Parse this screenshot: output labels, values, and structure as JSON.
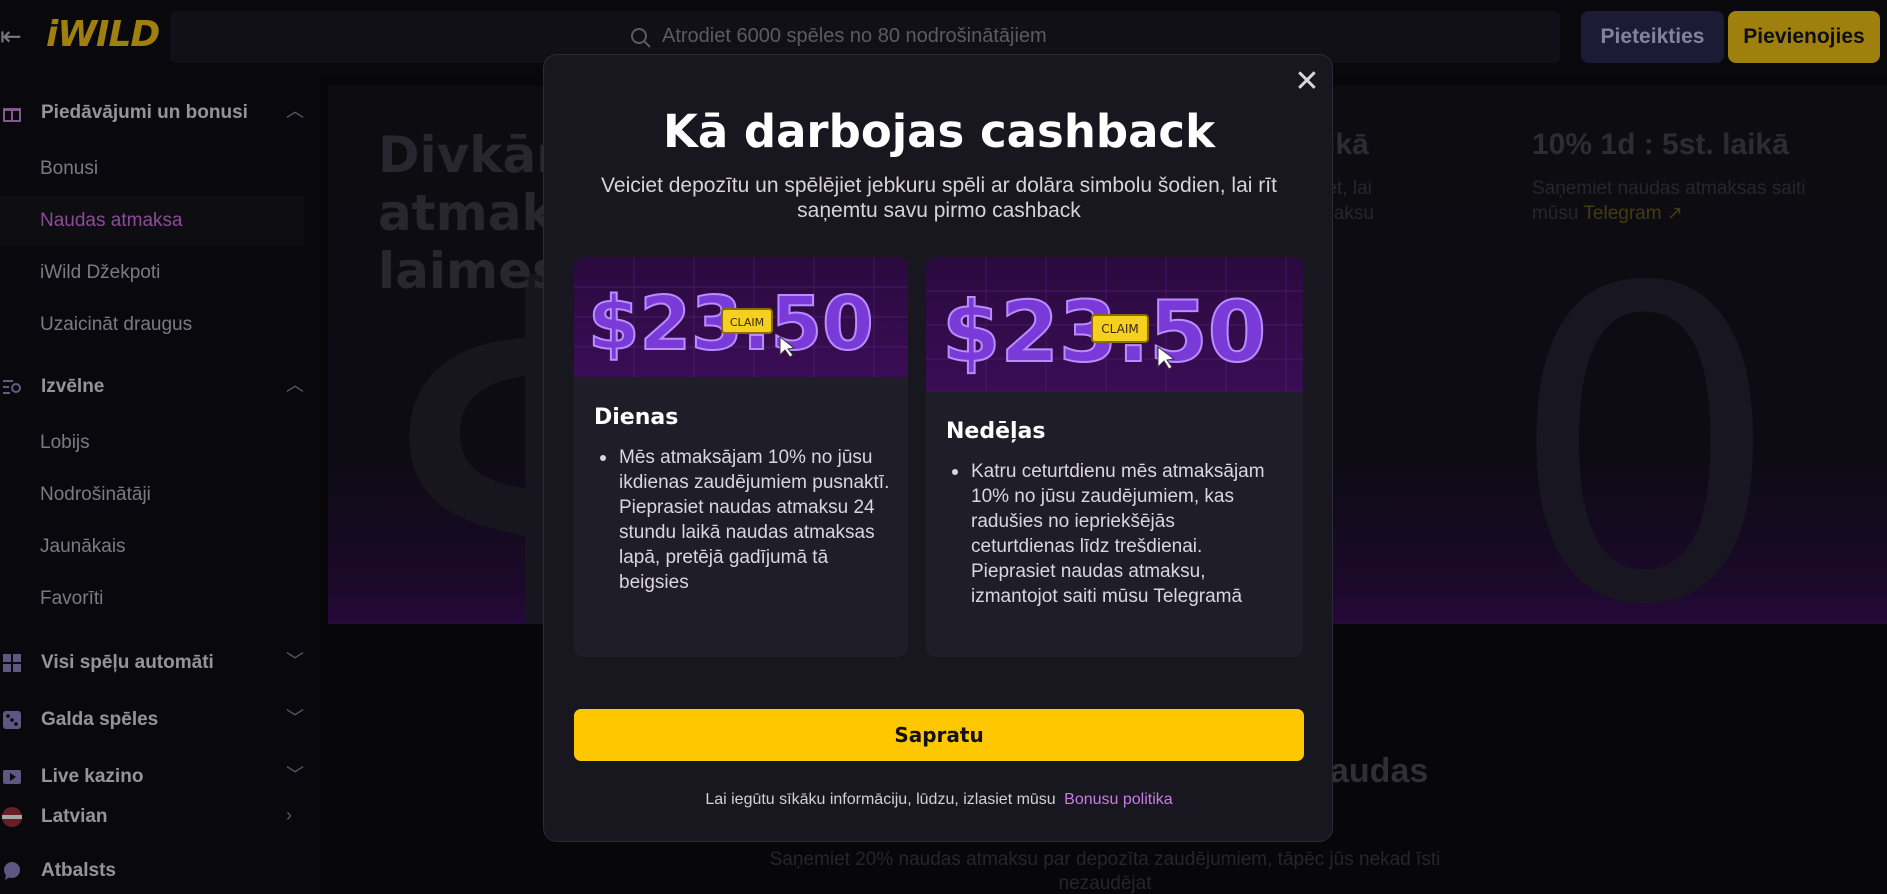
{
  "topbar": {
    "logo": "iWILD",
    "search_placeholder": "Atrodiet 6000 spēles no 80 nodrošinātājiem",
    "login_label": "Pieteikties",
    "join_label": "Pievienojies"
  },
  "sidebar": {
    "bonuses_section": "Piedāvājumi un bonusi",
    "bonus_items": [
      "Bonusi",
      "Naudas atmaksa",
      "iWild Džekpoti",
      "Uzaicināt draugus"
    ],
    "menu_section": "Izvēlne",
    "menu_items": [
      "Lobijs",
      "Nodrošinātāji",
      "Jaunākais",
      "Favorīti"
    ],
    "slots_section": "Visi spēļu automāti",
    "table_section": "Galda spēles",
    "live_section": "Live kazino",
    "language": "Latvian",
    "support": "Atbalsts"
  },
  "background": {
    "hero_title": "Divkārš atmak laimes",
    "promo_mid_title": "laikā",
    "promo_mid_text": "jiet, lai\nmaksu",
    "promo_right_title": "10% 1d : 5st. laikā",
    "promo_right_text": "Saņemiet naudas atmaksas saiti mūsu",
    "promo_right_link": "Telegram ↗",
    "bottom_heading": "audas",
    "bottom_text": "Saņemiet 20% naudas atmaksu par depozīta zaudējumiem, tāpēc jūs nekad īsti nezaudējat"
  },
  "modal": {
    "title": "Kā darbojas cashback",
    "subtitle": "Veiciet depozītu un spēlējiet jebkuru spēli ar dolāra simbolu šodien, lai rīt saņemtu savu pirmo cashback",
    "card_image_amount": "$23.50",
    "card_image_badge": "CLAIM",
    "daily": {
      "heading": "Dienas",
      "text": "Mēs atmaksājam 10% no jūsu ikdienas zaudējumiem pusnaktī. Pieprasiet naudas atmaksu 24 stundu laikā naudas atmaksas lapā, pretējā gadījumā tā beigsies"
    },
    "weekly": {
      "heading": "Nedēļas",
      "text": "Katru ceturtdienu mēs atmaksājam 10% no jūsu zaudējumiem, kas radušies no iepriekšējās ceturtdienas līdz trešdienai. Pieprasiet naudas atmaksu, izmantojot saiti mūsu Telegramā"
    },
    "ok_label": "Sapratu",
    "footer_text": "Lai iegūtu sīkāku informāciju, lūdzu, izlasiet mūsu",
    "footer_link": "Bonusu politika"
  },
  "colors": {
    "accent_yellow": "#ffc700",
    "accent_purple": "#c77ce8",
    "active_pink": "#d774e8"
  }
}
